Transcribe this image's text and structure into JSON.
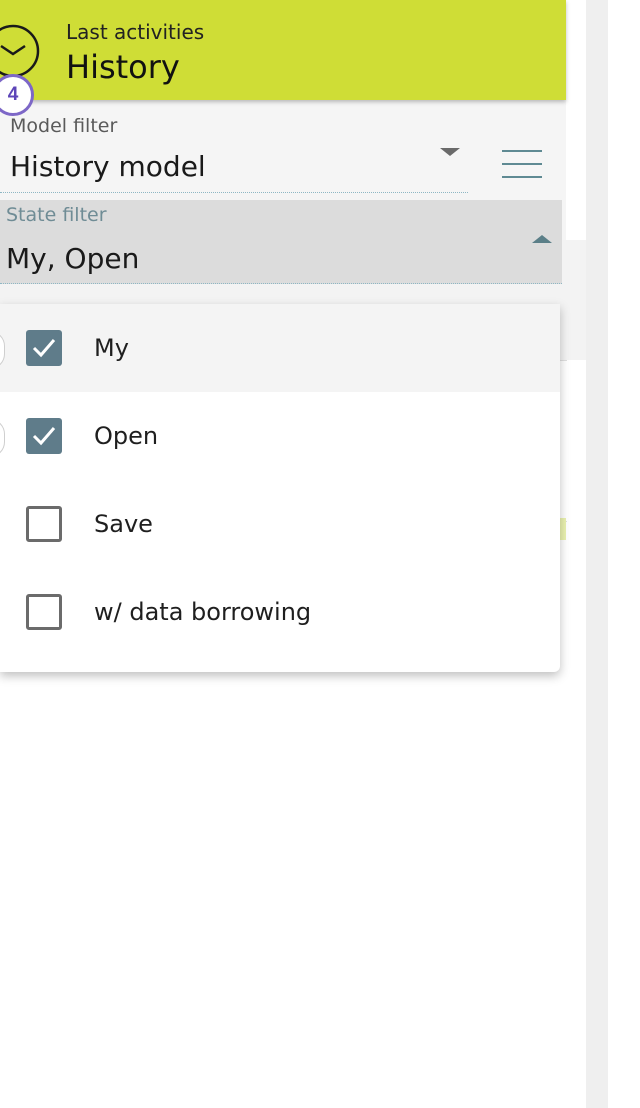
{
  "header": {
    "subtitle": "Last activities",
    "title": "History",
    "badge_count": "4",
    "icon": "clock-icon",
    "accent_color": "#cfdd36"
  },
  "model_filter": {
    "label": "Model filter",
    "value": "History model"
  },
  "state_filter": {
    "label": "State filter",
    "value": "My, Open",
    "options": [
      {
        "label": "My",
        "checked": true
      },
      {
        "label": "Open",
        "checked": true
      },
      {
        "label": "Save",
        "checked": false
      },
      {
        "label": "w/ data borrowing",
        "checked": false
      }
    ]
  },
  "colors": {
    "badge_border": "#7d67c7",
    "checkbox_checked": "#5f7c8a"
  }
}
